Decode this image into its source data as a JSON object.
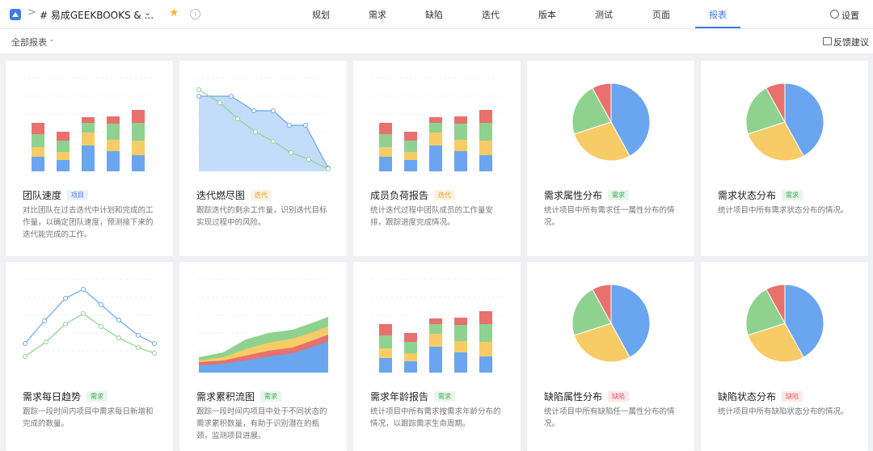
{
  "nav": {
    "breadcrumb_sep": ">",
    "project": "# 易成GEEKBOOKS & ...",
    "tabs": [
      "规划",
      "需求",
      "缺陷",
      "迭代",
      "版本",
      "测试",
      "页面",
      "报表"
    ],
    "active_tab": "报表",
    "settings": "设置"
  },
  "subbar": {
    "filter": "全部报表",
    "feedback": "反馈建议"
  },
  "colors": {
    "accent": "#3d7be8",
    "red": "#e8706d",
    "green": "#8fd28f",
    "yellow": "#f7cc67",
    "blue": "#6aa5ef"
  },
  "cards": [
    {
      "title": "团队速度",
      "tag": "项目",
      "tag_color": "blue",
      "desc": "对比团队在过去迭代中计划和完成的工作量，以确定团队速度，预测接下来的迭代能完成的工作。",
      "chart": "stacked-bar"
    },
    {
      "title": "迭代燃尽图",
      "tag": "迭代",
      "tag_color": "orange",
      "desc": "跟踪迭代的剩余工作量，识别迭代目标实现过程中的风险。",
      "chart": "burndown"
    },
    {
      "title": "成员负荷报告",
      "tag": "迭代",
      "tag_color": "orange",
      "desc": "统计迭代过程中团队成员的工作量安排，跟踪进度完成情况。",
      "chart": "stacked-bar"
    },
    {
      "title": "需求属性分布",
      "tag": "需求",
      "tag_color": "green",
      "desc": "统计项目中所有需求任一属性分布的情况。",
      "chart": "pie"
    },
    {
      "title": "需求状态分布",
      "tag": "需求",
      "tag_color": "green",
      "desc": "统计项目中所有需求状态分布的情况。",
      "chart": "pie"
    },
    {
      "title": "需求每日趋势",
      "tag": "需求",
      "tag_color": "green",
      "desc": "跟踪一段时间内项目中需求每日新增和完成的数量。",
      "chart": "trend"
    },
    {
      "title": "需求累积流图",
      "tag": "需求",
      "tag_color": "green",
      "desc": "跟踪一段时间内项目中处于不同状态的需求累积数量，有助于识别潜在的瓶颈，监测项目进展。",
      "chart": "cfd"
    },
    {
      "title": "需求年龄报告",
      "tag": "需求",
      "tag_color": "green",
      "desc": "统计项目中所有需求按需求年龄分布的情况，以跟踪需求生命周期。",
      "chart": "stacked-bar"
    },
    {
      "title": "缺陷属性分布",
      "tag": "缺陷",
      "tag_color": "red",
      "desc": "统计项目中所有缺陷任一属性分布的情况。",
      "chart": "pie"
    },
    {
      "title": "缺陷状态分布",
      "tag": "缺陷",
      "tag_color": "red",
      "desc": "统计项目中所有缺陷状态分布的情况。",
      "chart": "pie"
    }
  ]
}
